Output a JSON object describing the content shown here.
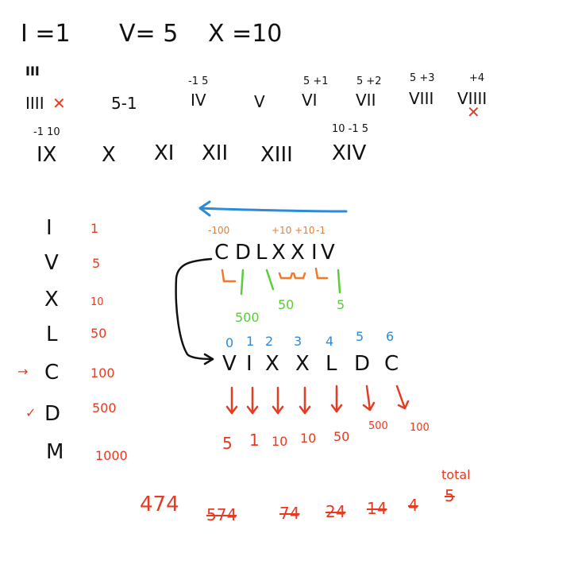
{
  "equations": [
    "I =1",
    "V= 5",
    "X =10"
  ],
  "row1": {
    "tally_top": "III",
    "items": [
      {
        "main": "IIII",
        "note": ""
      },
      {
        "main": "5-1",
        "note": ""
      },
      {
        "main": "IV",
        "note": "-1 5"
      },
      {
        "main": "V",
        "note": ""
      },
      {
        "main": "VI",
        "note": "5 +1"
      },
      {
        "main": "VII",
        "note": "5 +2"
      },
      {
        "main": "VIII",
        "note": "5 +3"
      },
      {
        "main": "VIIII",
        "note": "+4"
      }
    ],
    "cross": "✕"
  },
  "row2": {
    "items": [
      {
        "main": "IX",
        "note": "-1 10"
      },
      {
        "main": "X",
        "note": ""
      },
      {
        "main": "XI",
        "note": ""
      },
      {
        "main": "XII",
        "note": ""
      },
      {
        "main": "XIII",
        "note": ""
      },
      {
        "main": "XIV",
        "note": "10 -1 5"
      }
    ]
  },
  "table": [
    {
      "symbol": "I",
      "value": "1",
      "mark": ""
    },
    {
      "symbol": "V",
      "value": "5",
      "mark": ""
    },
    {
      "symbol": "X",
      "value": "10",
      "mark": ""
    },
    {
      "symbol": "L",
      "value": "50",
      "mark": ""
    },
    {
      "symbol": "C",
      "value": "100",
      "mark": "→"
    },
    {
      "symbol": "D",
      "value": "500",
      "mark": "✓"
    },
    {
      "symbol": "M",
      "value": "1000",
      "mark": ""
    }
  ],
  "word": {
    "letters": [
      "C",
      "D",
      "L",
      "X",
      "X",
      "I",
      "V"
    ],
    "ops": [
      "-100",
      "+10 +10",
      "-1"
    ],
    "group_values": [
      "500",
      "50",
      "5"
    ]
  },
  "reversed": {
    "indices": [
      "0",
      "1",
      "2",
      "3",
      "4",
      "5",
      "6"
    ],
    "letters": [
      "V",
      "I",
      "X",
      "X",
      "L",
      "D",
      "C"
    ],
    "values": [
      "5",
      "1",
      "10",
      "10",
      "50",
      "500",
      "100"
    ]
  },
  "sums": {
    "result": "474",
    "crossed": [
      "574",
      "74",
      "24",
      "14",
      "4",
      "5"
    ],
    "total_label": "total"
  },
  "colors": {
    "ink": "#111111",
    "red": "#e53b22",
    "green": "#5ccc3a",
    "blue": "#2e8ad8",
    "orange": "#f07a2a"
  }
}
